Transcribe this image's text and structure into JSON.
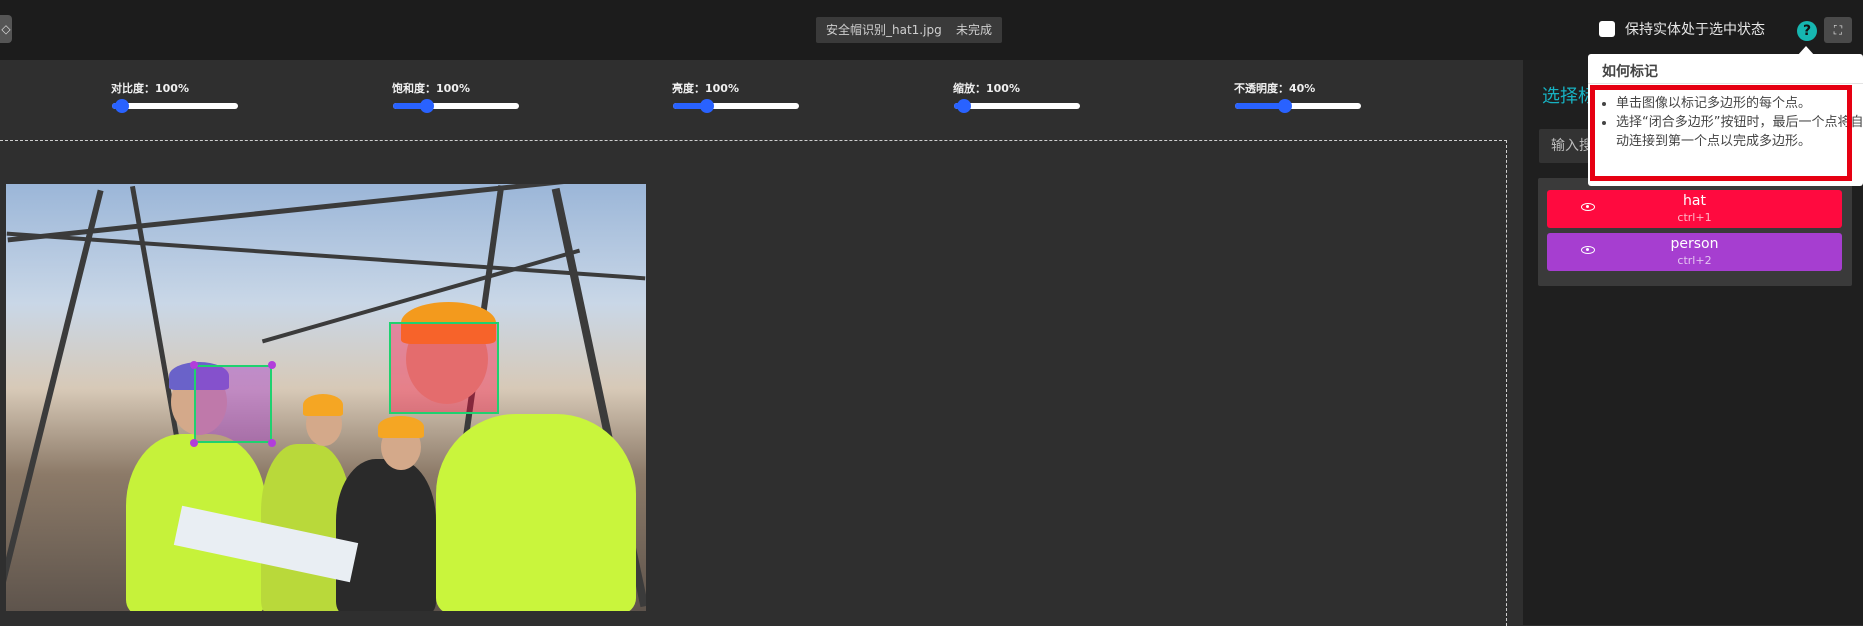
{
  "header": {
    "left_stub": "◇",
    "filename": "安全帽识别_hat1.jpg",
    "status": "未完成",
    "keep_selected_label": "保持实体处于选中状态",
    "help_icon": "?",
    "expand_icon": "⛶"
  },
  "tooltip": {
    "title": "如何标记",
    "tips": [
      "单击图像以标记多边形的每个点。",
      "选择“闭合多边形”按钮时，最后一个点将自动连接到第一个点以完成多边形。"
    ]
  },
  "sliders": [
    {
      "label": "对比度：100%",
      "value": 0.08
    },
    {
      "label": "饱和度：100%",
      "value": 0.27
    },
    {
      "label": "亮度：100%",
      "value": 0.27
    },
    {
      "label": "缩放：100%",
      "value": 0.08
    },
    {
      "label": "不透明度：40%",
      "value": 0.4
    }
  ],
  "right_panel": {
    "title": "选择标",
    "search_placeholder": "输入搜"
  },
  "labels": [
    {
      "name": "hat",
      "shortcut": "ctrl+1",
      "color": "#ff0a3f"
    },
    {
      "name": "person",
      "shortcut": "ctrl+2",
      "color": "#a63ed0"
    }
  ],
  "colors": {
    "accent": "#17b1c1",
    "slider": "#2962ff",
    "highlight": "#e60012"
  }
}
